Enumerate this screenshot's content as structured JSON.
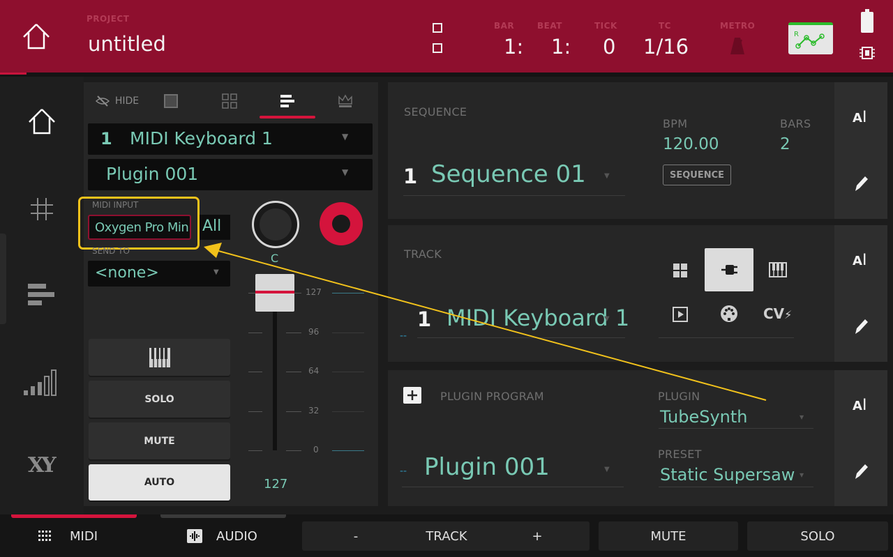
{
  "header": {
    "project_label": "PROJECT",
    "project_name": "untitled",
    "bar_label": "BAR",
    "beat_label": "BEAT",
    "tick_label": "TICK",
    "tc_label": "TC",
    "metro_label": "METRO",
    "bar_value": "1:",
    "beat_value": "1:",
    "tick_value": "0",
    "tc_value": "1/16"
  },
  "channel": {
    "tab_hide": "HIDE",
    "track_number": "1",
    "track_name": "MIDI Keyboard 1",
    "plugin_name": "Plugin 001",
    "midi_input_label": "MIDI INPUT",
    "midi_input_value": "Oxygen Pro Min...",
    "midi_channel": "All",
    "send_to_label": "SEND TO",
    "send_to_value": "<none>",
    "pan_value": "C",
    "solo_label": "SOLO",
    "mute_label": "MUTE",
    "auto_label": "AUTO",
    "fader_ticks": [
      "127",
      "96",
      "64",
      "32",
      "0"
    ],
    "fader_level": "127",
    "fader_position_fraction": 1.0
  },
  "sequence": {
    "label": "SEQUENCE",
    "number": "1",
    "name": "Sequence 01",
    "bpm_label": "BPM",
    "bpm_value": "120.00",
    "bars_label": "BARS",
    "bars_value": "2",
    "sequence_button": "SEQUENCE"
  },
  "track": {
    "label": "TRACK",
    "number": "1",
    "name": "MIDI Keyboard 1",
    "prefix": "--",
    "cv_label": "CV"
  },
  "plugin_program": {
    "label": "PLUGIN PROGRAM",
    "prefix": "--",
    "name": "Plugin 001",
    "plugin_label": "PLUGIN",
    "plugin_value": "TubeSynth",
    "preset_label": "PRESET",
    "preset_value": "Static Supersaw"
  },
  "bottom": {
    "midi": "MIDI",
    "audio": "AUDIO",
    "minus": "-",
    "track": "TRACK",
    "plus": "+",
    "mute": "MUTE",
    "solo": "SOLO"
  },
  "colors": {
    "header_bg": "#8e0f2e",
    "accent_red": "#d4143c",
    "teal": "#79c9b4",
    "highlight_yellow": "#f2c21b"
  },
  "icons": {
    "home": "home-icon",
    "grid": "grid-icon",
    "mixer": "mixer-icon",
    "levels": "level-bars-icon",
    "xy": "xy-icon"
  }
}
